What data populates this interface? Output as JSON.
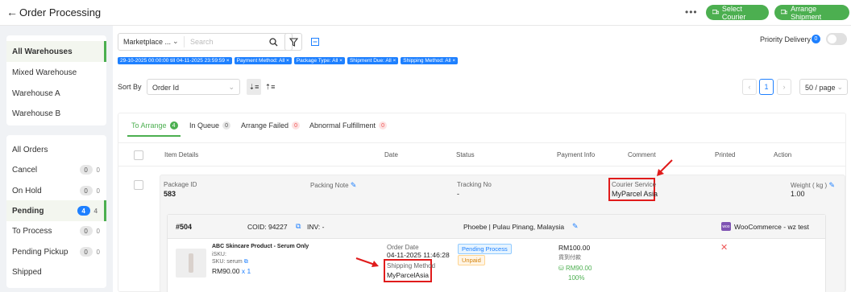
{
  "header": {
    "back_icon": "back-arrow-icon",
    "title": "Order Processing",
    "more": "•••",
    "select_courier": "Select Courier",
    "arrange_shipment": "Arrange Shipment"
  },
  "warehouses": [
    {
      "label": "All Warehouses",
      "active": true
    },
    {
      "label": "Mixed Warehouse"
    },
    {
      "label": "Warehouse A"
    },
    {
      "label": "Warehouse B"
    }
  ],
  "statuses": [
    {
      "label": "All Orders"
    },
    {
      "label": "Cancel",
      "badge": "0",
      "count": "0"
    },
    {
      "label": "On Hold",
      "badge": "0",
      "count": "0"
    },
    {
      "label": "Pending",
      "badge": "4",
      "count": "4",
      "active": true
    },
    {
      "label": "To Process",
      "badge": "0",
      "count": "0"
    },
    {
      "label": "Pending Pickup",
      "badge": "0",
      "count": "0"
    },
    {
      "label": "Shipped"
    }
  ],
  "filters": {
    "marketplace": "Marketplace ...",
    "search_placeholder": "Search",
    "chips": [
      "29-10-2025 00:00:00 till 04-11-2025 23:59:59 ×",
      "Payment Method: All ×",
      "Package Type: All ×",
      "Shipment Due: All ×",
      "Shipping Method: All ×"
    ],
    "priority_label": "Priority Delivery",
    "priority_count": "0"
  },
  "sort": {
    "label": "Sort By",
    "value": "Order Id",
    "page": "1",
    "page_size": "50 / page"
  },
  "tabs": [
    {
      "label": "To Arrange",
      "badge": "4",
      "active": true
    },
    {
      "label": "In Queue",
      "badge": "0"
    },
    {
      "label": "Arrange Failed",
      "badge": "0"
    },
    {
      "label": "Abnormal Fulfillment",
      "badge": "0"
    }
  ],
  "columns": [
    "Item Details",
    "Date",
    "Status",
    "Payment Info",
    "Comment",
    "Printed",
    "Action"
  ],
  "package": {
    "id_label": "Package ID",
    "id": "583",
    "packing_note_label": "Packing Note",
    "tracking_label": "Tracking No",
    "tracking": "-",
    "courier_label": "Courier Service",
    "courier": "MyParcel Asia",
    "weight_label": "Weight ( kg )",
    "weight": "1.00"
  },
  "order": {
    "number": "#504",
    "coid": "COID: 94227",
    "inv": "INV: -",
    "customer": "Phoebe |  Pulau Pinang, Malaysia",
    "store": "WooCommerce - wz test",
    "store_logo": "woo",
    "product_name": "ABC Skincare Product - Serum Only",
    "isku": "iSKU:",
    "sku": "SKU: serum",
    "price_qty": "RM90.00",
    "qty": "x 1",
    "order_date_label": "Order Date",
    "order_date": "04-11-2025 11:46:28",
    "shipping_method_label": "Shipping Method",
    "shipping_method": "MyParcelAsia",
    "status_process": "Pending Process",
    "status_payment": "Unpaid",
    "total": "RM100.00",
    "payment_method": "貨到付款",
    "paid_amount": "RM90.00",
    "paid_percent": "100%"
  },
  "colors": {
    "accent": "#4caf50",
    "blue": "#1e80ff",
    "highlight": "#e01b1b"
  }
}
